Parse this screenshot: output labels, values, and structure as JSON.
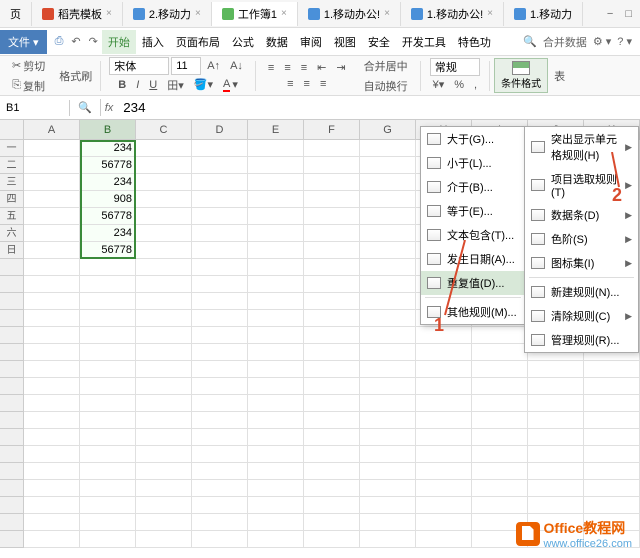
{
  "window_tabs": [
    {
      "label": "页",
      "icon": ""
    },
    {
      "label": "稻壳模板",
      "icon": "red"
    },
    {
      "label": "2.移动力",
      "icon": "blue"
    },
    {
      "label": "工作簿1",
      "icon": "green",
      "active": true
    },
    {
      "label": "1.移动办公!",
      "icon": "blue"
    },
    {
      "label": "1.移动办公!",
      "icon": "blue"
    },
    {
      "label": "1.移动力",
      "icon": "blue"
    }
  ],
  "menu": {
    "file": "文件",
    "items": [
      "开始",
      "插入",
      "页面布局",
      "公式",
      "数据",
      "审阅",
      "视图",
      "安全",
      "开发工具",
      "特色功"
    ],
    "active_index": 0,
    "search": "Q",
    "merge_data": "合并数据"
  },
  "toolbar": {
    "cut": "剪切",
    "copy": "复制",
    "format_painter": "格式刷",
    "font_name": "宋体",
    "font_size": "11",
    "merge_center": "合并居中",
    "wrap": "自动换行",
    "number_format": "常规",
    "cond_format": "条件格式",
    "table": "表"
  },
  "formula_bar": {
    "name_box": "B1",
    "fx": "fx",
    "value": "234"
  },
  "columns": [
    "A",
    "B",
    "C",
    "D",
    "E",
    "F",
    "G",
    "H",
    "I",
    "J",
    "K"
  ],
  "selected_col": "B",
  "row_headers": [
    "一",
    "二",
    "三",
    "四",
    "五",
    "六",
    "日",
    "",
    "",
    "",
    "",
    "",
    "",
    "",
    "",
    "",
    "",
    "",
    "",
    "",
    "",
    "",
    "",
    ""
  ],
  "data_col_b": [
    "234",
    "56778",
    "234",
    "908",
    "56778",
    "234",
    "56778"
  ],
  "dropdown1": {
    "items": [
      {
        "label": "大于(G)..."
      },
      {
        "label": "小于(L)..."
      },
      {
        "label": "介于(B)..."
      },
      {
        "label": "等于(E)..."
      },
      {
        "label": "文本包含(T)..."
      },
      {
        "label": "发生日期(A)..."
      },
      {
        "label": "重复值(D)...",
        "highlighted": true
      },
      {
        "label": "其他规则(M)...",
        "separated": true
      }
    ]
  },
  "dropdown2": {
    "items": [
      {
        "label": "突出显示单元格规则(H)",
        "arrow": true
      },
      {
        "label": "项目选取规则(T)",
        "arrow": true
      },
      {
        "label": "数据条(D)",
        "arrow": true
      },
      {
        "label": "色阶(S)",
        "arrow": true
      },
      {
        "label": "图标集(I)",
        "arrow": true
      },
      {
        "label": "新建规则(N)...",
        "separated": true
      },
      {
        "label": "清除规则(C)",
        "arrow": true
      },
      {
        "label": "管理规则(R)..."
      }
    ]
  },
  "annotations": {
    "a1": "1",
    "a2": "2"
  },
  "watermark": {
    "title": "Office教程网",
    "url": "www.office26.com"
  }
}
